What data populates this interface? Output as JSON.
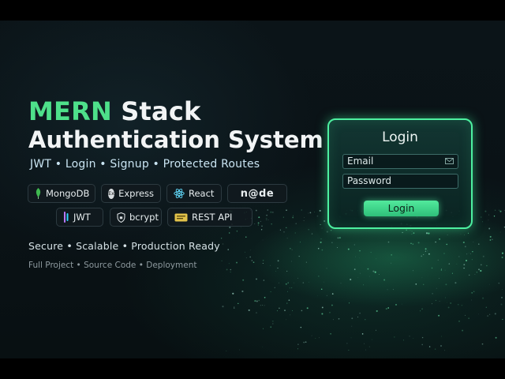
{
  "headline": {
    "accent": "MERN",
    "rest": "Stack",
    "line2": "Authentication System"
  },
  "subtitle": "JWT • Login • Signup • Protected Routes",
  "badges": [
    {
      "label": "MongoDB",
      "icon": "mongodb-leaf-icon"
    },
    {
      "label": "Express",
      "icon": "express-icon"
    },
    {
      "label": "React",
      "icon": "react-atom-icon"
    },
    {
      "label": "n@de",
      "icon": "nodejs-logo"
    },
    {
      "label": "JWT",
      "icon": "jwt-icon"
    },
    {
      "label": "bcrypt",
      "icon": "bcrypt-shield-icon"
    },
    {
      "label": "REST API",
      "icon": "rest-api-icon"
    }
  ],
  "express_icon_text": "Ex",
  "tagline": "Secure • Scalable • Production Ready",
  "smallline": "Full Project • Source Code • Deployment",
  "login_card": {
    "title": "Login",
    "email_placeholder": "Email",
    "password_placeholder": "Password",
    "button_label": "Login"
  },
  "colors": {
    "accent_green": "#4ee08a",
    "card_border": "#4df0a0",
    "button": "#41d68c",
    "background": "#0a1216"
  }
}
